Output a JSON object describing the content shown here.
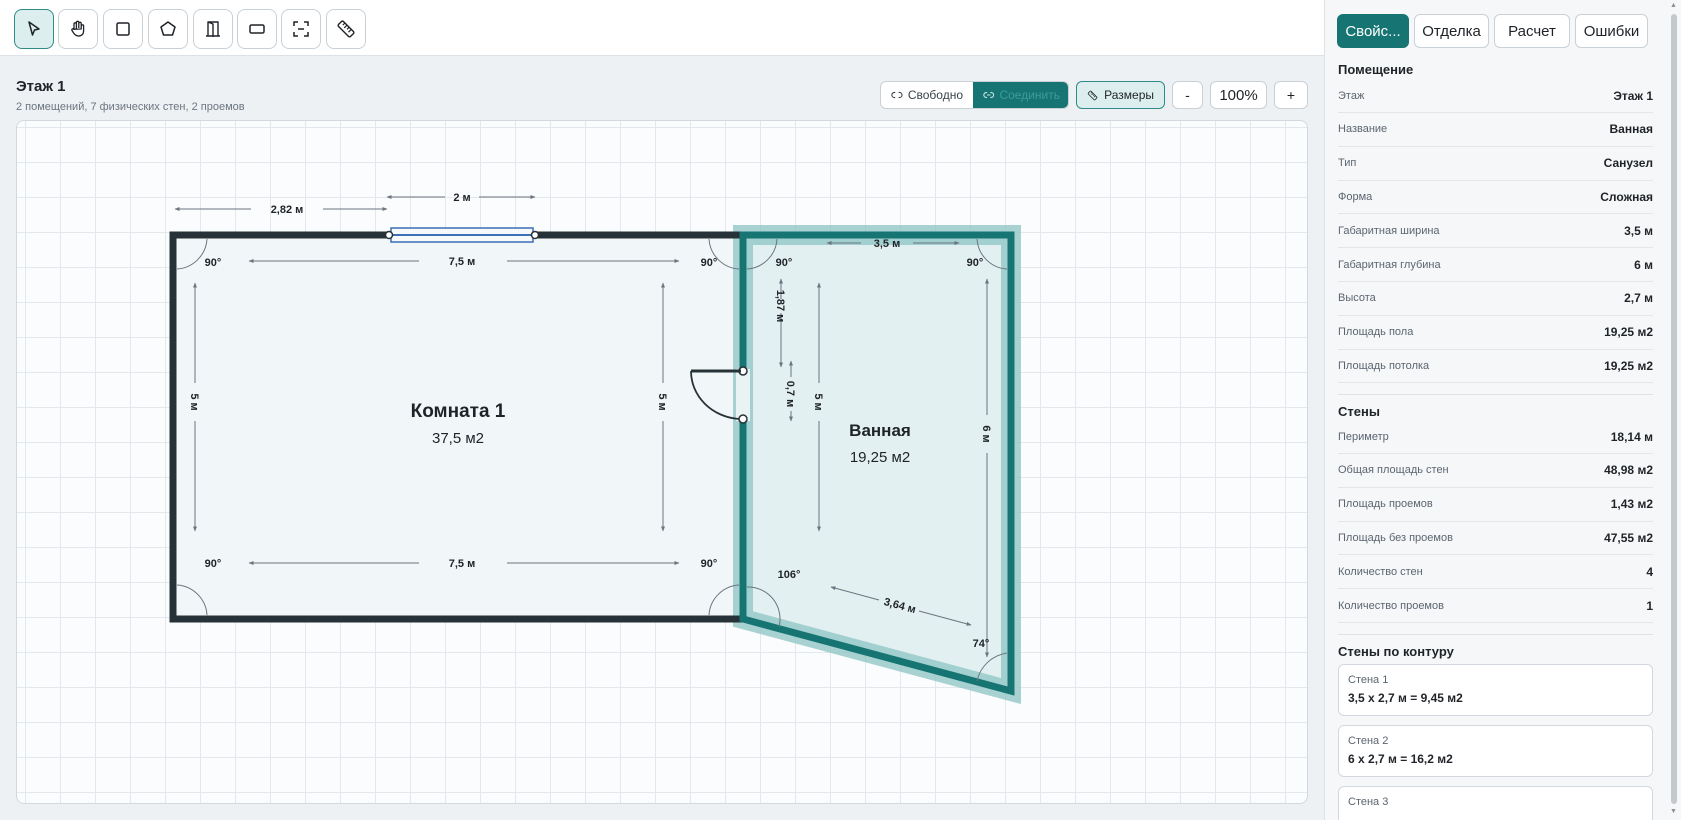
{
  "toolbar": {
    "tools": [
      {
        "name": "select-tool",
        "icon": "cursor-icon",
        "active": true
      },
      {
        "name": "pan-tool",
        "icon": "hand-icon",
        "active": false
      },
      {
        "name": "rect-room-tool",
        "icon": "square-icon",
        "active": false
      },
      {
        "name": "polygon-room-tool",
        "icon": "pentagon-icon",
        "active": false
      },
      {
        "name": "door-tool",
        "icon": "door-icon",
        "active": false
      },
      {
        "name": "window-tool",
        "icon": "window-rect-icon",
        "active": false
      },
      {
        "name": "opening-tool",
        "icon": "dashed-frame-icon",
        "active": false
      },
      {
        "name": "ruler-tool",
        "icon": "ruler-icon",
        "active": false
      }
    ]
  },
  "floor": {
    "title": "Этаж 1",
    "subtitle": "2 помещений, 7 физических стен, 2 проемов"
  },
  "controls": {
    "free_label": "Свободно",
    "connect_label": "Соединить",
    "sizes_label": "Размеры",
    "zoom_out": "-",
    "zoom_value": "100%",
    "zoom_in": "+"
  },
  "plan": {
    "room1": {
      "name": "Комната 1",
      "area": "37,5 м2"
    },
    "room2": {
      "name": "Ванная",
      "area": "19,25 м2"
    },
    "dims": {
      "d_282": "2,82 м",
      "d_2": "2 м",
      "d_75_top": "7,5 м",
      "d_35": "3,5 м",
      "d_187": "1,87 м",
      "d_07": "0,7 м",
      "d_5_left": "5 м",
      "d_5_mid": "5 м",
      "d_5_bath": "5 м",
      "d_6": "6 м",
      "d_75_bottom": "7,5 м",
      "d_364": "3,64 м"
    },
    "angles": {
      "a_tl": "90°",
      "a_tr": "90°",
      "a_bl": "90°",
      "a_br": "90°",
      "b_tl": "90°",
      "b_tr": "90°",
      "b_bl": "106°",
      "b_br": "74°"
    },
    "colors": {
      "wall": "#263238",
      "accent": "#167572",
      "window": "#3b6fb6"
    }
  },
  "panel": {
    "tabs": [
      "Свойс...",
      "Отделка",
      "Расчет",
      "Ошибки"
    ],
    "room_section": "Помещение",
    "room_rows": [
      {
        "k": "Этаж",
        "v": "Этаж 1"
      },
      {
        "k": "Название",
        "v": "Ванная"
      },
      {
        "k": "Тип",
        "v": "Санузел"
      },
      {
        "k": "Форма",
        "v": "Сложная"
      },
      {
        "k": "Габаритная ширина",
        "v": "3,5 м"
      },
      {
        "k": "Габаритная глубина",
        "v": "6 м"
      },
      {
        "k": "Высота",
        "v": "2,7 м"
      },
      {
        "k": "Площадь пола",
        "v": "19,25 м2"
      },
      {
        "k": "Площадь потолка",
        "v": "19,25 м2"
      }
    ],
    "walls_section": "Стены",
    "wall_rows": [
      {
        "k": "Периметр",
        "v": "18,14 м"
      },
      {
        "k": "Общая площадь стен",
        "v": "48,98 м2"
      },
      {
        "k": "Площадь проемов",
        "v": "1,43 м2"
      },
      {
        "k": "Площадь без проемов",
        "v": "47,55 м2"
      },
      {
        "k": "Количество стен",
        "v": "4"
      },
      {
        "k": "Количество проемов",
        "v": "1"
      }
    ],
    "contour_section": "Стены по контуру",
    "contour": [
      {
        "t": "Стена 1",
        "d": "3,5 x 2,7 м = 9,45 м2"
      },
      {
        "t": "Стена 2",
        "d": "6 x 2,7 м = 16,2 м2"
      },
      {
        "t": "Стена 3",
        "d": ""
      }
    ]
  }
}
